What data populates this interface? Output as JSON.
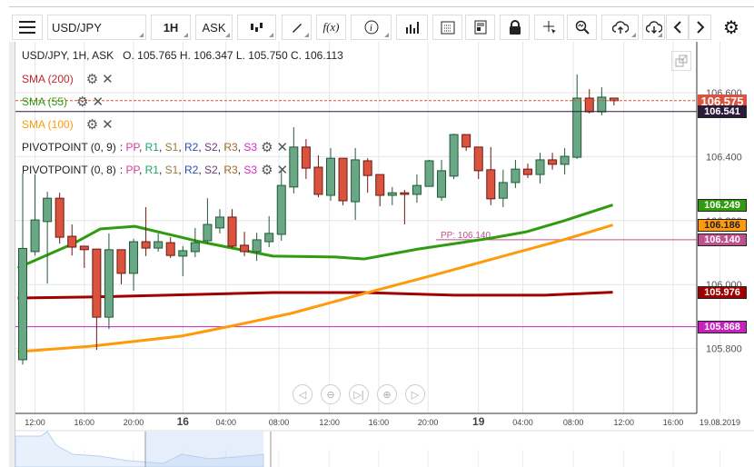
{
  "toolbar": {
    "symbol": "USD/JPY",
    "timeframe": "1H",
    "price_type": "ASK",
    "fx_label": "f(x)"
  },
  "legend": {
    "header": "USD/JPY, 1H, ASK",
    "ohlc": "O. 105.765 H. 106.347 L. 105.750 C. 106.113",
    "sma200": "SMA (200)",
    "sma55": "SMA (55)",
    "sma100": "SMA (100)",
    "pivot9": "PIVOTPOINT (0, 9)",
    "pivot8": "PIVOTPOINT (0, 8)",
    "pivot_items": [
      {
        "t": "PP",
        "c": "#d63fa0"
      },
      {
        "t": "R1",
        "c": "#1fa36a"
      },
      {
        "t": "S1",
        "c": "#9a7b3a"
      },
      {
        "t": "R2",
        "c": "#2d4fb3"
      },
      {
        "t": "S2",
        "c": "#6b3a7a"
      },
      {
        "t": "R3",
        "c": "#9a6a2a"
      },
      {
        "t": "S3",
        "c": "#d628c8"
      }
    ]
  },
  "colors": {
    "up": "#6aa784",
    "down": "#d9533f",
    "sma200": "#a00000",
    "sma55": "#2e9c0e",
    "sma100": "#ff9a0b",
    "pp": "#c0508f",
    "s_line": "#c820c0",
    "crosshair": "#2c1a3a"
  },
  "price_axis": {
    "ticks": [
      "106.600",
      "106.400",
      "106.200",
      "106.000",
      "105.800"
    ],
    "tick_values": [
      106.6,
      106.4,
      106.2,
      106.0,
      105.8
    ],
    "labels": [
      {
        "text": "106.575",
        "value": 106.575,
        "bg": "#d9533f"
      },
      {
        "text": "106.541",
        "value": 106.541,
        "bg": "#2c1a3a"
      },
      {
        "text": "106.249",
        "value": 106.249,
        "bg": "#2e9c0e"
      },
      {
        "text": "106.186",
        "value": 106.186,
        "bg": "#ff9a0b"
      },
      {
        "text": "106.140",
        "value": 106.14,
        "bg": "#c0508f"
      },
      {
        "text": "105.976",
        "value": 105.976,
        "bg": "#a00000"
      },
      {
        "text": "105.868",
        "value": 105.868,
        "bg": "#c820c0"
      }
    ]
  },
  "pp_label": "PP: 106.140",
  "time_axis": [
    {
      "t": "12:00",
      "i": 2
    },
    {
      "t": "16:00",
      "i": 6
    },
    {
      "t": "20:00",
      "i": 10
    },
    {
      "t": "16",
      "i": 14,
      "bold": true
    },
    {
      "t": "04:00",
      "i": 17.5
    },
    {
      "t": "08:00",
      "i": 21.8
    },
    {
      "t": "12:00",
      "i": 25.9
    },
    {
      "t": "16:00",
      "i": 29.9
    },
    {
      "t": "20:00",
      "i": 33.9
    },
    {
      "t": "19",
      "i": 38,
      "bold": true
    },
    {
      "t": "04:00",
      "i": 41.6
    },
    {
      "t": "08:00",
      "i": 45.7
    },
    {
      "t": "12:00",
      "i": 49.8
    },
    {
      "t": "16:00",
      "i": 53.8
    },
    {
      "t": "19.08.2019",
      "i": 57.6
    }
  ],
  "chart_data": {
    "type": "candlestick",
    "candles": [
      [
        105.765,
        106.347,
        105.75,
        106.113
      ],
      [
        106.103,
        106.344,
        106.091,
        106.202
      ],
      [
        106.197,
        106.29,
        106.003,
        106.27
      ],
      [
        106.27,
        106.287,
        106.128,
        106.148
      ],
      [
        106.151,
        106.188,
        106.091,
        106.117
      ],
      [
        106.12,
        106.12,
        106.052,
        106.109
      ],
      [
        106.111,
        106.111,
        105.796,
        105.898
      ],
      [
        105.898,
        106.16,
        105.861,
        106.109
      ],
      [
        106.109,
        106.109,
        106.001,
        106.035
      ],
      [
        106.035,
        106.143,
        105.981,
        106.134
      ],
      [
        106.134,
        106.242,
        106.089,
        106.114
      ],
      [
        106.114,
        106.16,
        106.103,
        106.134
      ],
      [
        106.131,
        106.148,
        106.083,
        106.091
      ],
      [
        106.089,
        106.12,
        106.026,
        106.106
      ],
      [
        106.103,
        106.177,
        106.086,
        106.131
      ],
      [
        106.137,
        106.27,
        106.128,
        106.188
      ],
      [
        106.177,
        106.236,
        106.16,
        106.211
      ],
      [
        106.211,
        106.236,
        106.114,
        106.12
      ],
      [
        106.123,
        106.165,
        106.089,
        106.103
      ],
      [
        106.103,
        106.162,
        106.074,
        106.14
      ],
      [
        106.134,
        106.214,
        106.117,
        106.16
      ],
      [
        106.157,
        106.359,
        106.137,
        106.31
      ],
      [
        106.305,
        106.492,
        106.285,
        106.43
      ],
      [
        106.43,
        106.455,
        106.33,
        106.364
      ],
      [
        106.367,
        106.404,
        106.273,
        106.282
      ],
      [
        106.279,
        106.427,
        106.262,
        106.395
      ],
      [
        106.395,
        106.395,
        106.248,
        106.262
      ],
      [
        106.259,
        106.427,
        106.202,
        106.39
      ],
      [
        106.387,
        106.395,
        106.287,
        106.341
      ],
      [
        106.344,
        106.344,
        106.245,
        106.279
      ],
      [
        106.279,
        106.305,
        106.248,
        106.287
      ],
      [
        106.287,
        106.296,
        106.188,
        106.282
      ],
      [
        106.282,
        106.344,
        106.256,
        106.31
      ],
      [
        106.307,
        106.39,
        106.307,
        106.387
      ],
      [
        106.273,
        106.39,
        106.262,
        106.356
      ],
      [
        106.339,
        106.472,
        106.33,
        106.469
      ],
      [
        106.469,
        106.469,
        106.418,
        106.43
      ],
      [
        106.43,
        106.43,
        106.33,
        106.356
      ],
      [
        106.359,
        106.43,
        106.248,
        106.268
      ],
      [
        106.27,
        106.359,
        106.242,
        106.319
      ],
      [
        106.319,
        106.39,
        106.302,
        106.361
      ],
      [
        106.361,
        106.378,
        106.333,
        106.344
      ],
      [
        106.344,
        106.412,
        106.316,
        106.39
      ],
      [
        106.39,
        106.412,
        106.359,
        106.376
      ],
      [
        106.376,
        106.427,
        106.344,
        106.401
      ],
      [
        106.398,
        106.657,
        106.393,
        106.583
      ],
      [
        106.583,
        106.611,
        106.535,
        106.54
      ],
      [
        106.54,
        106.617,
        106.529,
        106.586
      ],
      [
        106.583,
        106.583,
        106.56,
        106.575
      ]
    ],
    "sma55": [
      [
        0.6,
        106.052
      ],
      [
        5.1,
        106.128
      ],
      [
        7.3,
        106.174
      ],
      [
        10.1,
        106.182
      ],
      [
        15.4,
        106.134
      ],
      [
        21.3,
        106.089
      ],
      [
        26.4,
        106.086
      ],
      [
        28.7,
        106.08
      ],
      [
        33.1,
        106.111
      ],
      [
        39.0,
        106.145
      ],
      [
        41.9,
        106.165
      ],
      [
        44.9,
        106.199
      ],
      [
        48.9,
        106.249
      ]
    ],
    "sma100": [
      [
        0.6,
        105.79
      ],
      [
        6.5,
        105.807
      ],
      [
        13.9,
        105.839
      ],
      [
        18.3,
        105.873
      ],
      [
        22.8,
        105.91
      ],
      [
        28.7,
        105.972
      ],
      [
        34.6,
        106.032
      ],
      [
        40.5,
        106.094
      ],
      [
        44.9,
        106.14
      ],
      [
        48.9,
        106.186
      ]
    ],
    "sma200": [
      [
        0.6,
        105.958
      ],
      [
        6.5,
        105.961
      ],
      [
        21.3,
        105.975
      ],
      [
        28.7,
        105.975
      ],
      [
        36,
        105.967
      ],
      [
        43.4,
        105.967
      ],
      [
        48.9,
        105.976
      ]
    ],
    "pp": 106.14,
    "s_level": 105.868,
    "last": 106.575,
    "crosshair": 106.541,
    "ylim": [
      105.72,
      106.77
    ]
  }
}
